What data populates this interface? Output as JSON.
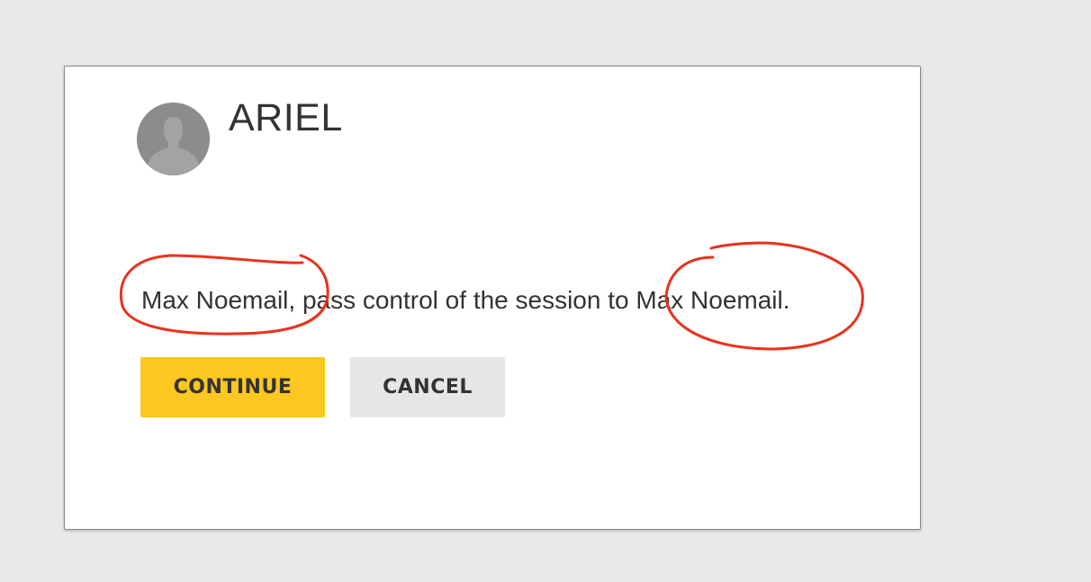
{
  "dialog": {
    "user_name": "ARIEL",
    "avatar_icon": "person-silhouette-icon",
    "message": "Max Noemail, pass control of the session to Max Noemail.",
    "continue_label": "CONTINUE",
    "cancel_label": "CANCEL"
  },
  "colors": {
    "background": "#e9e9e9",
    "dialog_background": "#ffffff",
    "continue_button": "#fcc720",
    "cancel_button": "#e6e6e6",
    "text": "#333333",
    "annotation_circle": "#e8321d"
  }
}
